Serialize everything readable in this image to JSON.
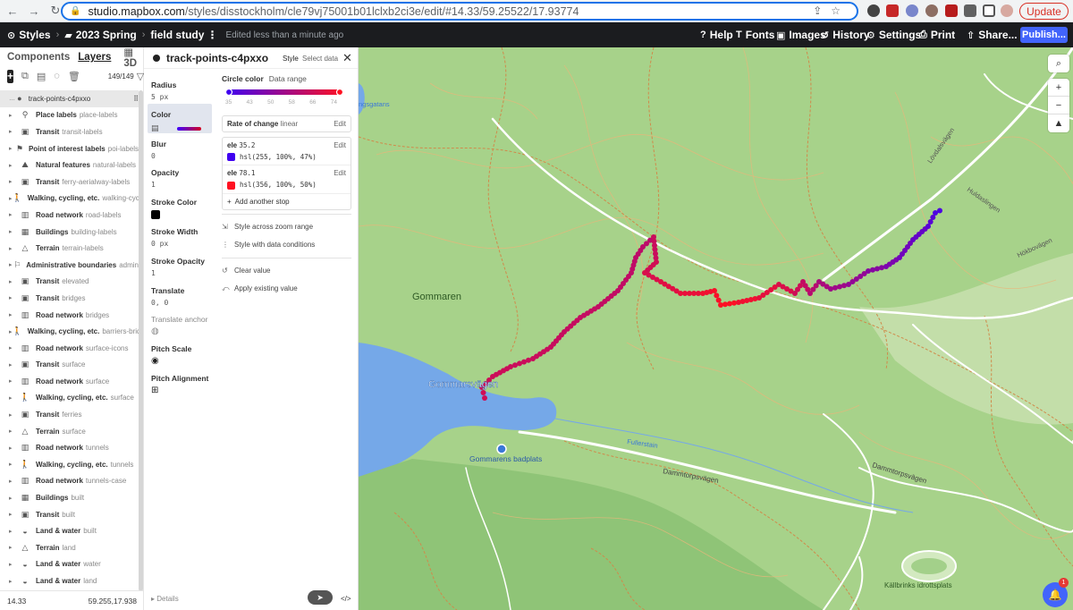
{
  "browser": {
    "url_host": "studio.mapbox.com",
    "url_path": "/styles/disstockholm/cle79vj75001b01lclxb2ci3e/edit/#14.33/59.25522/17.93774",
    "update_label": "Update"
  },
  "topbar": {
    "styles": "Styles",
    "folder": "2023 Spring",
    "style_name": "field study",
    "edited": "Edited less than a minute ago",
    "help": "Help",
    "fonts": "Fonts",
    "images": "Images",
    "history": "History",
    "settings": "Settings",
    "print": "Print",
    "share": "Share...",
    "publish": "Publish..."
  },
  "left_panel": {
    "tabs": [
      "Components",
      "Layers",
      "3D"
    ],
    "count": "149/149",
    "layers": [
      {
        "group": "",
        "name": "track-points-c4pxxo",
        "icon": "dot"
      },
      {
        "group": "Place labels",
        "name": "place-labels",
        "icon": "place"
      },
      {
        "group": "Transit",
        "name": "transit-labels",
        "icon": "transit"
      },
      {
        "group": "Point of interest labels",
        "name": "poi-labels",
        "icon": "pin"
      },
      {
        "group": "Natural features",
        "name": "natural-labels",
        "icon": "mountain"
      },
      {
        "group": "Transit",
        "name": "ferry-aerialway-labels",
        "icon": "transit"
      },
      {
        "group": "Walking, cycling, etc.",
        "name": "walking-cycling",
        "icon": "walk"
      },
      {
        "group": "Road network",
        "name": "road-labels",
        "icon": "road"
      },
      {
        "group": "Buildings",
        "name": "building-labels",
        "icon": "building"
      },
      {
        "group": "Terrain",
        "name": "terrain-labels",
        "icon": "terrain"
      },
      {
        "group": "Administrative boundaries",
        "name": "admin",
        "icon": "flag"
      },
      {
        "group": "Transit",
        "name": "elevated",
        "icon": "transit"
      },
      {
        "group": "Transit",
        "name": "bridges",
        "icon": "transit"
      },
      {
        "group": "Road network",
        "name": "bridges",
        "icon": "road"
      },
      {
        "group": "Walking, cycling, etc.",
        "name": "barriers-bridge",
        "icon": "walk"
      },
      {
        "group": "Road network",
        "name": "surface-icons",
        "icon": "road"
      },
      {
        "group": "Transit",
        "name": "surface",
        "icon": "transit"
      },
      {
        "group": "Road network",
        "name": "surface",
        "icon": "road"
      },
      {
        "group": "Walking, cycling, etc.",
        "name": "surface",
        "icon": "walk"
      },
      {
        "group": "Transit",
        "name": "ferries",
        "icon": "transit"
      },
      {
        "group": "Terrain",
        "name": "surface",
        "icon": "terrain"
      },
      {
        "group": "Road network",
        "name": "tunnels",
        "icon": "road"
      },
      {
        "group": "Walking, cycling, etc.",
        "name": "tunnels",
        "icon": "walk"
      },
      {
        "group": "Road network",
        "name": "tunnels-case",
        "icon": "road"
      },
      {
        "group": "Buildings",
        "name": "built",
        "icon": "building"
      },
      {
        "group": "Transit",
        "name": "built",
        "icon": "transit"
      },
      {
        "group": "Land & water",
        "name": "built",
        "icon": "land"
      },
      {
        "group": "Terrain",
        "name": "land",
        "icon": "terrain"
      },
      {
        "group": "Land & water",
        "name": "water",
        "icon": "land"
      },
      {
        "group": "Land & water",
        "name": "land",
        "icon": "land"
      }
    ],
    "zoom": "14.33",
    "coords": "59.255,17.938"
  },
  "middle_panel": {
    "title": "track-points-c4pxxo",
    "tab_style": "Style",
    "tab_select": "Select data",
    "props": [
      {
        "label": "Radius",
        "value": "5 px"
      },
      {
        "label": "Color",
        "value": ""
      },
      {
        "label": "Blur",
        "value": "0"
      },
      {
        "label": "Opacity",
        "value": "1"
      },
      {
        "label": "Stroke Color",
        "value": ""
      },
      {
        "label": "Stroke Width",
        "value": "0 px"
      },
      {
        "label": "Stroke Opacity",
        "value": "1"
      },
      {
        "label": "Translate",
        "value": "0,  0"
      },
      {
        "label": "Translate anchor",
        "value": ""
      },
      {
        "label": "Pitch Scale",
        "value": ""
      },
      {
        "label": "Pitch Alignment",
        "value": ""
      }
    ],
    "editor": {
      "heading": "Circle color",
      "mode": "Data range",
      "ticks": [
        "35",
        "43",
        "50",
        "58",
        "66",
        "74"
      ],
      "rate_label": "Rate of change",
      "rate_value": "linear",
      "edit": "Edit",
      "stops": [
        {
          "prop": "ele",
          "value": "35.2",
          "color": "hsl(255,  100%,  47%)",
          "swatch": "#3f00f0"
        },
        {
          "prop": "ele",
          "value": "78.1",
          "color": "hsl(356,  100%,  50%)",
          "swatch": "#ff1122"
        }
      ],
      "add_stop": "Add another stop",
      "zoom_range": "Style across zoom range",
      "data_cond": "Style with data conditions",
      "clear": "Clear value",
      "apply": "Apply existing value"
    },
    "details": "Details"
  },
  "map": {
    "labels": {
      "gommaren": "Gommaren",
      "gommarsvagen": "Gommarsvägen",
      "badplats": "Gommarens badplats",
      "damm": "Dammtorpsvägen",
      "damm2": "Dammtorpsvägen",
      "kalbrinks": "Källbrinks idrottsplats",
      "lovdala": "Lövdalsvägen",
      "huld": "Huldaslingen",
      "holk": "Hökbovägen",
      "fullerstain": "Fullerstain",
      "ngsgatans": "ngsgatans"
    },
    "help_badge": "1"
  }
}
